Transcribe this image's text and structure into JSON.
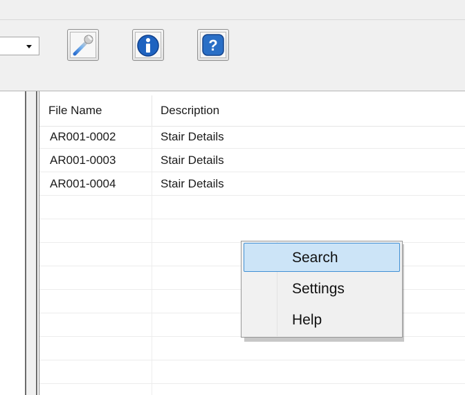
{
  "toolbar": {
    "combo_value": "",
    "buttons": [
      {
        "icon": "wrench-icon"
      },
      {
        "icon": "info-icon"
      },
      {
        "icon": "help-icon"
      }
    ]
  },
  "list": {
    "columns": [
      "File Name",
      "Description"
    ],
    "rows": [
      {
        "file": "AR001-0002",
        "description": "Stair Details"
      },
      {
        "file": "AR001-0003",
        "description": "Stair Details"
      },
      {
        "file": "AR001-0004",
        "description": "Stair Details"
      }
    ]
  },
  "context_menu": {
    "items": [
      {
        "label": "Search",
        "highlighted": true
      },
      {
        "label": "Settings",
        "highlighted": false
      },
      {
        "label": "Help",
        "highlighted": false
      }
    ]
  },
  "colors": {
    "accent": "#3f8fd4",
    "highlight": "#cce4f7",
    "icon_blue": "#2a6fc6"
  }
}
